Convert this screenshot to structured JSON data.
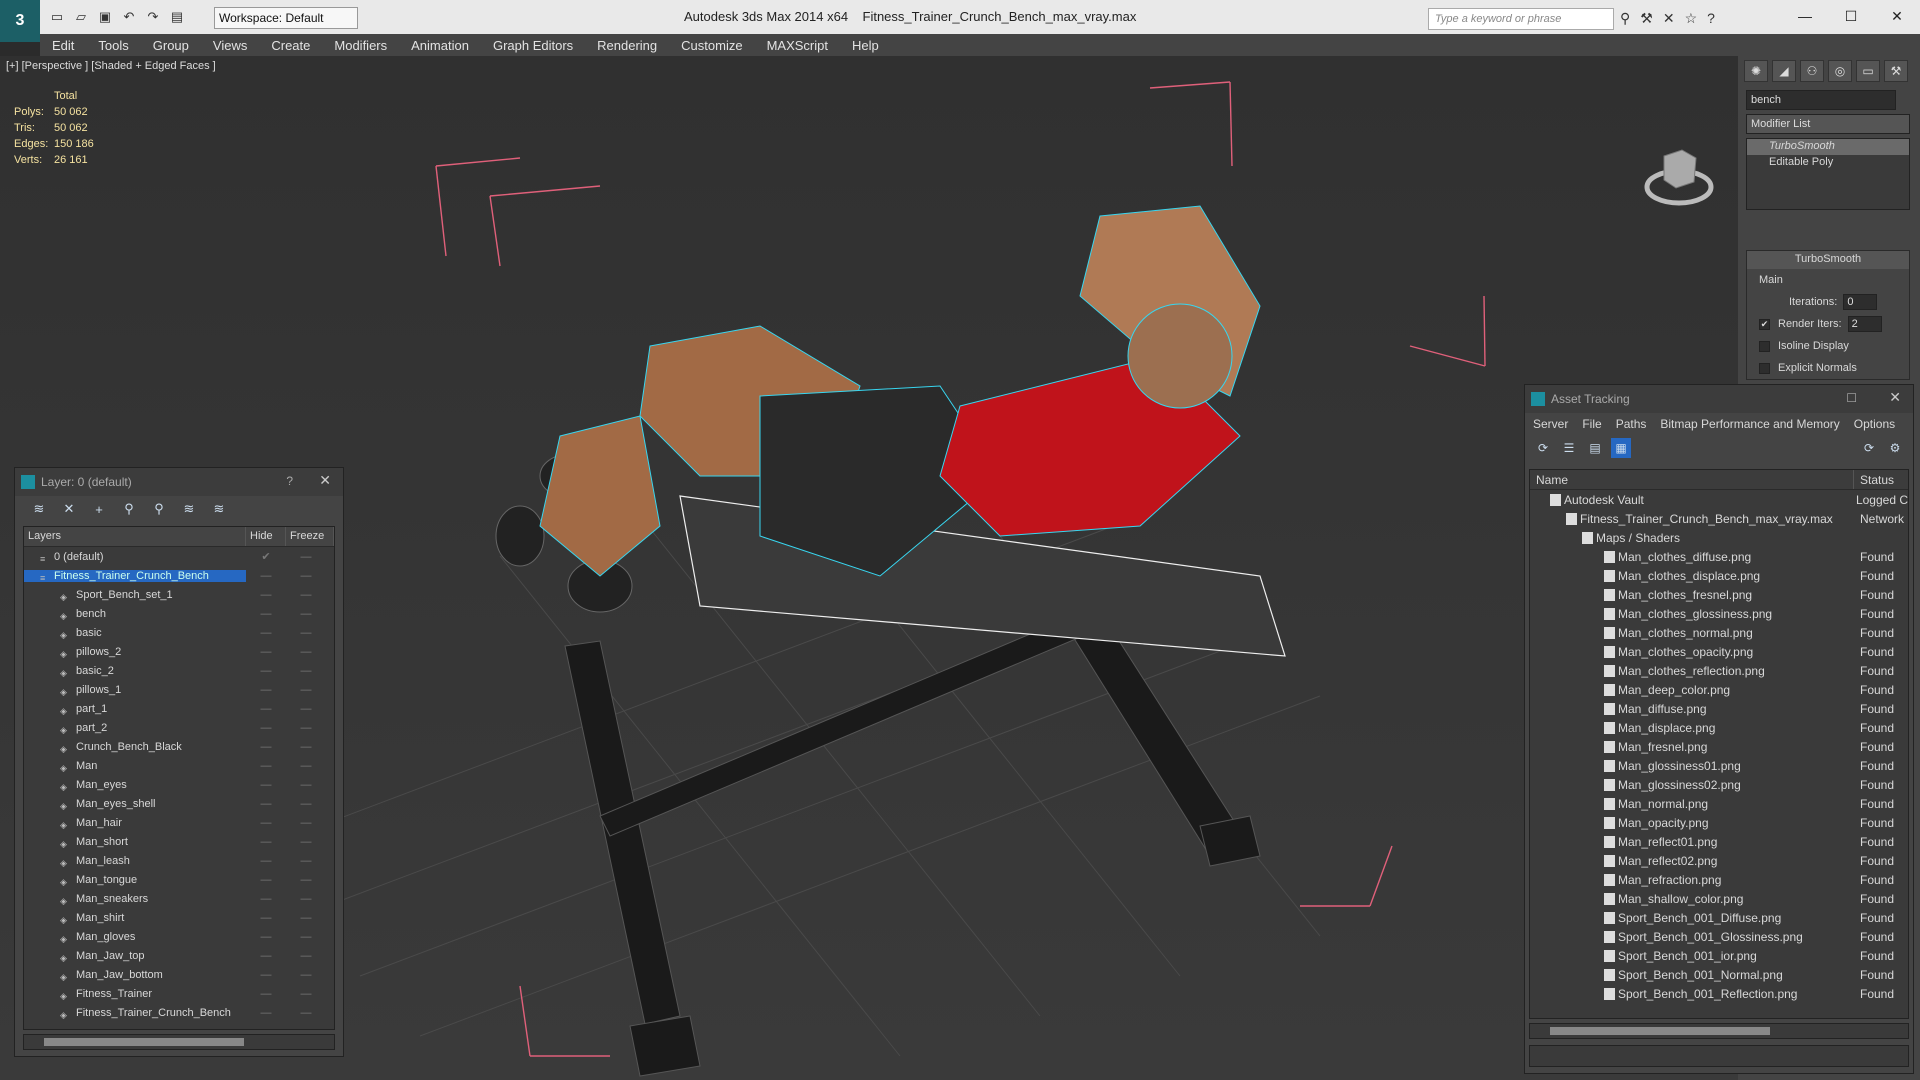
{
  "app": {
    "title": "Autodesk 3ds Max  2014 x64",
    "filename": "Fitness_Trainer_Crunch_Bench_max_vray.max",
    "workspace": "Workspace: Default",
    "search_placeholder": "Type a keyword or phrase"
  },
  "menu": [
    "Edit",
    "Tools",
    "Group",
    "Views",
    "Create",
    "Modifiers",
    "Animation",
    "Graph Editors",
    "Rendering",
    "Customize",
    "MAXScript",
    "Help"
  ],
  "viewport": {
    "label": "[+] [Perspective ] [Shaded + Edged Faces ]",
    "stats": {
      "header": "Total",
      "rows": [
        {
          "k": "Polys:",
          "v": "50 062"
        },
        {
          "k": "Tris:",
          "v": "50 062"
        },
        {
          "k": "Edges:",
          "v": "150 186"
        },
        {
          "k": "Verts:",
          "v": "26 161"
        }
      ]
    }
  },
  "command_panel": {
    "object_name": "bench",
    "modifier_list": "Modifier List",
    "stack": [
      "TurboSmooth",
      "Editable Poly"
    ],
    "rollout_title": "TurboSmooth",
    "main_label": "Main",
    "iterations_label": "Iterations:",
    "iterations_value": "0",
    "render_iters_label": "Render Iters:",
    "render_iters_value": "2",
    "isoline": "Isoline Display",
    "explicit": "Explicit Normals"
  },
  "layer_window": {
    "title": "Layer: 0 (default)",
    "help": "?",
    "columns": {
      "layers": "Layers",
      "hide": "Hide",
      "freeze": "Freeze"
    },
    "rows": [
      {
        "name": "0 (default)",
        "level": "top",
        "sel": false
      },
      {
        "name": "Fitness_Trainer_Crunch_Bench",
        "level": "top",
        "sel": true
      },
      {
        "name": "Sport_Bench_set_1",
        "level": "child",
        "sel": false
      },
      {
        "name": "bench",
        "level": "child",
        "sel": false
      },
      {
        "name": "basic",
        "level": "child",
        "sel": false
      },
      {
        "name": "pillows_2",
        "level": "child",
        "sel": false
      },
      {
        "name": "basic_2",
        "level": "child",
        "sel": false
      },
      {
        "name": "pillows_1",
        "level": "child",
        "sel": false
      },
      {
        "name": "part_1",
        "level": "child",
        "sel": false
      },
      {
        "name": "part_2",
        "level": "child",
        "sel": false
      },
      {
        "name": "Crunch_Bench_Black",
        "level": "child",
        "sel": false
      },
      {
        "name": "Man",
        "level": "child",
        "sel": false
      },
      {
        "name": "Man_eyes",
        "level": "child",
        "sel": false
      },
      {
        "name": "Man_eyes_shell",
        "level": "child",
        "sel": false
      },
      {
        "name": "Man_hair",
        "level": "child",
        "sel": false
      },
      {
        "name": "Man_short",
        "level": "child",
        "sel": false
      },
      {
        "name": "Man_leash",
        "level": "child",
        "sel": false
      },
      {
        "name": "Man_tongue",
        "level": "child",
        "sel": false
      },
      {
        "name": "Man_sneakers",
        "level": "child",
        "sel": false
      },
      {
        "name": "Man_shirt",
        "level": "child",
        "sel": false
      },
      {
        "name": "Man_gloves",
        "level": "child",
        "sel": false
      },
      {
        "name": "Man_Jaw_top",
        "level": "child",
        "sel": false
      },
      {
        "name": "Man_Jaw_bottom",
        "level": "child",
        "sel": false
      },
      {
        "name": "Fitness_Trainer",
        "level": "child",
        "sel": false
      },
      {
        "name": "Fitness_Trainer_Crunch_Bench",
        "level": "child",
        "sel": false
      }
    ]
  },
  "asset_window": {
    "title": "Asset Tracking",
    "menu": [
      "Server",
      "File",
      "Paths",
      "Bitmap Performance and Memory",
      "Options"
    ],
    "columns": {
      "name": "Name",
      "status": "Status"
    },
    "rows": [
      {
        "name": "Autodesk Vault",
        "status": "Logged C",
        "indent": 0
      },
      {
        "name": "Fitness_Trainer_Crunch_Bench_max_vray.max",
        "status": "Network",
        "indent": 1
      },
      {
        "name": "Maps / Shaders",
        "status": "",
        "indent": 2
      },
      {
        "name": "Man_clothes_diffuse.png",
        "status": "Found",
        "indent": 3
      },
      {
        "name": "Man_clothes_displace.png",
        "status": "Found",
        "indent": 3
      },
      {
        "name": "Man_clothes_fresnel.png",
        "status": "Found",
        "indent": 3
      },
      {
        "name": "Man_clothes_glossiness.png",
        "status": "Found",
        "indent": 3
      },
      {
        "name": "Man_clothes_normal.png",
        "status": "Found",
        "indent": 3
      },
      {
        "name": "Man_clothes_opacity.png",
        "status": "Found",
        "indent": 3
      },
      {
        "name": "Man_clothes_reflection.png",
        "status": "Found",
        "indent": 3
      },
      {
        "name": "Man_deep_color.png",
        "status": "Found",
        "indent": 3
      },
      {
        "name": "Man_diffuse.png",
        "status": "Found",
        "indent": 3
      },
      {
        "name": "Man_displace.png",
        "status": "Found",
        "indent": 3
      },
      {
        "name": "Man_fresnel.png",
        "status": "Found",
        "indent": 3
      },
      {
        "name": "Man_glossiness01.png",
        "status": "Found",
        "indent": 3
      },
      {
        "name": "Man_glossiness02.png",
        "status": "Found",
        "indent": 3
      },
      {
        "name": "Man_normal.png",
        "status": "Found",
        "indent": 3
      },
      {
        "name": "Man_opacity.png",
        "status": "Found",
        "indent": 3
      },
      {
        "name": "Man_reflect01.png",
        "status": "Found",
        "indent": 3
      },
      {
        "name": "Man_reflect02.png",
        "status": "Found",
        "indent": 3
      },
      {
        "name": "Man_refraction.png",
        "status": "Found",
        "indent": 3
      },
      {
        "name": "Man_shallow_color.png",
        "status": "Found",
        "indent": 3
      },
      {
        "name": "Sport_Bench_001_Diffuse.png",
        "status": "Found",
        "indent": 3
      },
      {
        "name": "Sport_Bench_001_Glossiness.png",
        "status": "Found",
        "indent": 3
      },
      {
        "name": "Sport_Bench_001_ior.png",
        "status": "Found",
        "indent": 3
      },
      {
        "name": "Sport_Bench_001_Normal.png",
        "status": "Found",
        "indent": 3
      },
      {
        "name": "Sport_Bench_001_Reflection.png",
        "status": "Found",
        "indent": 3
      }
    ]
  },
  "colors": {
    "selection": "#2668c2",
    "stats": "#f5e2a0",
    "wire_cyan": "#38d6f0",
    "bbox_pink": "#e0607a"
  }
}
